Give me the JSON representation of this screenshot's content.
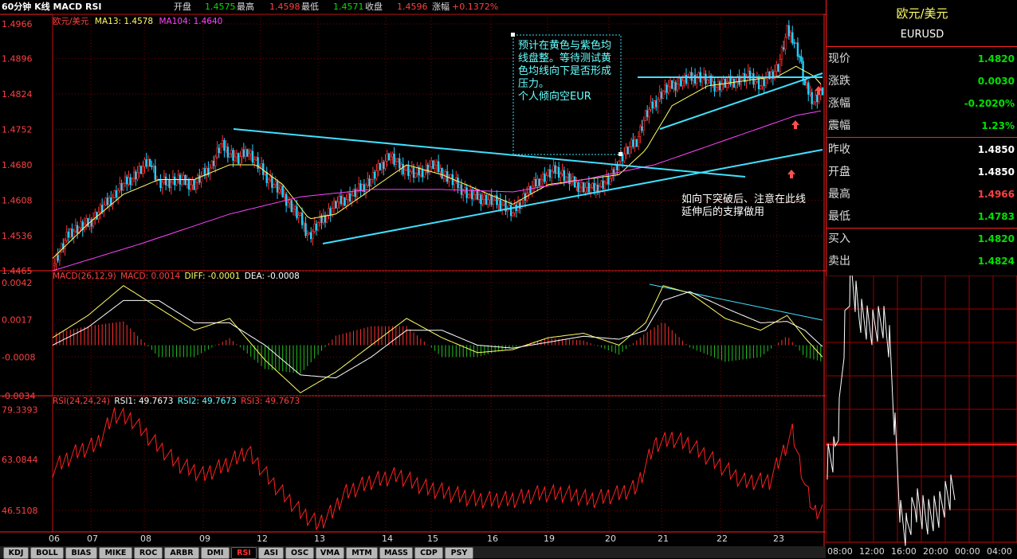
{
  "header": {
    "title": "60分钟 K线 MACD RSI",
    "open_label": "开盘",
    "open_value": "1.4575",
    "high_label": "最高",
    "high_value": "1.4598",
    "low_label": "最低",
    "low_value": "1.4571",
    "close_label": "收盘",
    "close_value": "1.4596",
    "change_label": "涨幅",
    "change_value": "+0.1372%"
  },
  "price_panel": {
    "symbol": "欧元/美元",
    "ma13_label": "MA13: 1.4578",
    "ma104_label": "MA104: 1.4640",
    "y_ticks": [
      "1.4966",
      "1.4896",
      "1.4824",
      "1.4752",
      "1.4680",
      "1.4608",
      "1.4536",
      "1.4465"
    ],
    "note1": "预计在黄色与紫色均线盘整。等待测试黄色均线向下是否形成压力。\n个人倾向空EUR",
    "note2": "如向下突破后、注意在此线延伸后的支撑做用"
  },
  "macd_panel": {
    "label": "MACD(26,12,9)",
    "macd_label": "MACD: 0.0014",
    "diff_label": "DIFF: -0.0001",
    "dea_label": "DEA: -0.0008",
    "y_ticks": [
      "0.0042",
      "0.0017",
      "-0.0008",
      "-0.0034"
    ]
  },
  "rsi_panel": {
    "label": "RSI(24,24,24)",
    "rsi1_label": "RSI1: 49.7673",
    "rsi2_label": "RSI2: 49.7673",
    "rsi3_label": "RSI3: 49.7673",
    "y_ticks": [
      "79.3393",
      "63.0844",
      "46.5108"
    ]
  },
  "x_axis_labels": [
    "06",
    "07",
    "08",
    "09",
    "12",
    "13",
    "14",
    "15",
    "16",
    "19",
    "20",
    "21",
    "22",
    "23"
  ],
  "tabs": [
    "KDJ",
    "BOLL",
    "BIAS",
    "MIKE",
    "ROC",
    "ARBR",
    "DMI",
    "RSI",
    "ASI",
    "OSC",
    "VMA",
    "MTM",
    "MASS",
    "CDP",
    "PSY"
  ],
  "active_tab": "RSI",
  "quote_panel": {
    "name": "欧元/美元",
    "code": "EURUSD",
    "rows": [
      {
        "label": "现价",
        "value": "1.4820",
        "color": "#00e000"
      },
      {
        "label": "涨跌",
        "value": "0.0030",
        "color": "#00e000"
      },
      {
        "label": "涨幅",
        "value": "-0.2020%",
        "color": "#00e000"
      },
      {
        "label": "震幅",
        "value": "1.23%",
        "color": "#00e000"
      },
      {
        "label": "昨收",
        "value": "1.4850",
        "color": "#ffffff"
      },
      {
        "label": "开盘",
        "value": "1.4850",
        "color": "#ffffff"
      },
      {
        "label": "最高",
        "value": "1.4966",
        "color": "#ff4040"
      },
      {
        "label": "最低",
        "value": "1.4783",
        "color": "#00e000"
      },
      {
        "label": "买入",
        "value": "1.4820",
        "color": "#00e000"
      },
      {
        "label": "卖出",
        "value": "1.4824",
        "color": "#00e000"
      }
    ]
  },
  "intraday_x_labels": [
    "08:00",
    "12:00",
    "16:00",
    "20:00",
    "00:00",
    "04:00"
  ],
  "chart_data": {
    "type": "candlestick",
    "title": "60分钟 K线 MACD RSI",
    "instrument": "欧元/美元",
    "x_labels": [
      "06",
      "07",
      "08",
      "09",
      "12",
      "13",
      "14",
      "15",
      "16",
      "19",
      "20",
      "21",
      "22",
      "23"
    ],
    "price_ylim": [
      1.4465,
      1.4966
    ],
    "price_path": [
      [
        0,
        1.4475
      ],
      [
        10,
        1.4545
      ],
      [
        20,
        1.456
      ],
      [
        30,
        1.46
      ],
      [
        40,
        1.464
      ],
      [
        50,
        1.467
      ],
      [
        55,
        1.469
      ],
      [
        60,
        1.464
      ],
      [
        70,
        1.465
      ],
      [
        80,
        1.464
      ],
      [
        90,
        1.468
      ],
      [
        95,
        1.472
      ],
      [
        105,
        1.469
      ],
      [
        110,
        1.471
      ],
      [
        120,
        1.466
      ],
      [
        130,
        1.462
      ],
      [
        140,
        1.457
      ],
      [
        145,
        1.4535
      ],
      [
        150,
        1.456
      ],
      [
        160,
        1.46
      ],
      [
        170,
        1.462
      ],
      [
        180,
        1.465
      ],
      [
        190,
        1.47
      ],
      [
        195,
        1.468
      ],
      [
        205,
        1.466
      ],
      [
        215,
        1.468
      ],
      [
        225,
        1.465
      ],
      [
        235,
        1.462
      ],
      [
        245,
        1.461
      ],
      [
        255,
        1.46
      ],
      [
        260,
        1.458
      ],
      [
        265,
        1.461
      ],
      [
        275,
        1.465
      ],
      [
        285,
        1.467
      ],
      [
        295,
        1.464
      ],
      [
        305,
        1.463
      ],
      [
        315,
        1.465
      ],
      [
        320,
        1.469
      ],
      [
        330,
        1.473
      ],
      [
        335,
        1.478
      ],
      [
        345,
        1.483
      ],
      [
        355,
        1.485
      ],
      [
        365,
        1.486
      ],
      [
        375,
        1.484
      ],
      [
        385,
        1.485
      ],
      [
        395,
        1.486
      ],
      [
        400,
        1.484
      ],
      [
        405,
        1.486
      ],
      [
        410,
        1.488
      ],
      [
        415,
        1.495
      ],
      [
        418,
        1.494
      ],
      [
        422,
        1.49
      ],
      [
        425,
        1.484
      ],
      [
        430,
        1.481
      ],
      [
        435,
        1.483
      ]
    ],
    "ma13_path": [
      [
        0,
        1.449
      ],
      [
        20,
        1.456
      ],
      [
        40,
        1.462
      ],
      [
        60,
        1.465
      ],
      [
        80,
        1.465
      ],
      [
        100,
        1.468
      ],
      [
        115,
        1.468
      ],
      [
        130,
        1.464
      ],
      [
        145,
        1.457
      ],
      [
        160,
        1.458
      ],
      [
        180,
        1.463
      ],
      [
        200,
        1.468
      ],
      [
        220,
        1.466
      ],
      [
        240,
        1.463
      ],
      [
        260,
        1.46
      ],
      [
        280,
        1.464
      ],
      [
        300,
        1.465
      ],
      [
        320,
        1.466
      ],
      [
        335,
        1.471
      ],
      [
        350,
        1.48
      ],
      [
        370,
        1.484
      ],
      [
        390,
        1.485
      ],
      [
        410,
        1.486
      ],
      [
        420,
        1.488
      ],
      [
        430,
        1.486
      ],
      [
        435,
        1.484
      ]
    ],
    "ma104_path": [
      [
        0,
        1.4465
      ],
      [
        50,
        1.452
      ],
      [
        100,
        1.458
      ],
      [
        140,
        1.4615
      ],
      [
        180,
        1.463
      ],
      [
        220,
        1.463
      ],
      [
        260,
        1.4625
      ],
      [
        300,
        1.465
      ],
      [
        340,
        1.468
      ],
      [
        380,
        1.473
      ],
      [
        420,
        1.478
      ],
      [
        435,
        1.479
      ]
    ],
    "macd": {
      "ylim": [
        -0.0034,
        0.0042
      ],
      "diff_path": [
        [
          0,
          0.0005
        ],
        [
          20,
          0.002
        ],
        [
          40,
          0.004
        ],
        [
          60,
          0.0025
        ],
        [
          80,
          0.001
        ],
        [
          100,
          0.0018
        ],
        [
          120,
          -0.001
        ],
        [
          140,
          -0.0032
        ],
        [
          160,
          -0.0018
        ],
        [
          180,
          0.0
        ],
        [
          200,
          0.0018
        ],
        [
          220,
          0.0005
        ],
        [
          240,
          -0.0005
        ],
        [
          260,
          -0.0003
        ],
        [
          280,
          0.0005
        ],
        [
          300,
          0.0008
        ],
        [
          320,
          0.0
        ],
        [
          335,
          0.0015
        ],
        [
          345,
          0.004
        ],
        [
          360,
          0.0035
        ],
        [
          380,
          0.0018
        ],
        [
          400,
          0.001
        ],
        [
          415,
          0.002
        ],
        [
          425,
          0.0005
        ],
        [
          435,
          -0.0008
        ]
      ],
      "dea_path": [
        [
          0,
          0.0
        ],
        [
          20,
          0.0012
        ],
        [
          40,
          0.003
        ],
        [
          60,
          0.003
        ],
        [
          80,
          0.0015
        ],
        [
          100,
          0.0015
        ],
        [
          120,
          0.0
        ],
        [
          140,
          -0.002
        ],
        [
          160,
          -0.0022
        ],
        [
          180,
          -0.0008
        ],
        [
          200,
          0.001
        ],
        [
          220,
          0.001
        ],
        [
          240,
          0.0
        ],
        [
          260,
          -0.0002
        ],
        [
          280,
          0.0002
        ],
        [
          300,
          0.0006
        ],
        [
          320,
          0.0004
        ],
        [
          335,
          0.001
        ],
        [
          345,
          0.003
        ],
        [
          360,
          0.0036
        ],
        [
          380,
          0.0025
        ],
        [
          400,
          0.0015
        ],
        [
          415,
          0.0016
        ],
        [
          425,
          0.001
        ],
        [
          435,
          -0.0001
        ]
      ]
    },
    "rsi": {
      "ylim": [
        40,
        80
      ],
      "rsi_path": [
        [
          0,
          60
        ],
        [
          15,
          66
        ],
        [
          25,
          68
        ],
        [
          35,
          78
        ],
        [
          45,
          76
        ],
        [
          55,
          70
        ],
        [
          70,
          62
        ],
        [
          85,
          58
        ],
        [
          100,
          62
        ],
        [
          110,
          66
        ],
        [
          125,
          55
        ],
        [
          140,
          46
        ],
        [
          150,
          42
        ],
        [
          158,
          46
        ],
        [
          165,
          52
        ],
        [
          180,
          56
        ],
        [
          195,
          58
        ],
        [
          210,
          54
        ],
        [
          225,
          52
        ],
        [
          240,
          50
        ],
        [
          260,
          50
        ],
        [
          275,
          52
        ],
        [
          290,
          52
        ],
        [
          305,
          50
        ],
        [
          320,
          52
        ],
        [
          330,
          54
        ],
        [
          340,
          68
        ],
        [
          350,
          70
        ],
        [
          360,
          68
        ],
        [
          375,
          62
        ],
        [
          390,
          56
        ],
        [
          405,
          56
        ],
        [
          418,
          72
        ],
        [
          425,
          55
        ],
        [
          430,
          46
        ],
        [
          435,
          47
        ]
      ]
    },
    "intraday": {
      "ylim": [
        1.4783,
        1.4966
      ],
      "prev_close": 1.485
    }
  }
}
